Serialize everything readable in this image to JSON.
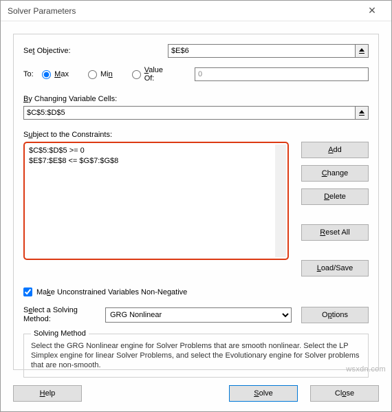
{
  "title": "Solver Parameters",
  "objective": {
    "label_pre": "Se",
    "label_und": "t",
    "label_post": " Objective:",
    "value": "$E$6"
  },
  "to": {
    "label": "To:",
    "max_und": "M",
    "max_post": "ax",
    "min_und": "M",
    "min_pre": "Mi",
    "min_post": "n",
    "min_label_pre": "Mi",
    "min_label_und": "n",
    "valueof_und": "V",
    "valueof_post": "alue Of:",
    "valueof_value": "0"
  },
  "changing": {
    "label_und": "B",
    "label_post": "y Changing Variable Cells:",
    "value": "$C$5:$D$5"
  },
  "constraints": {
    "label_pre": "S",
    "label_und": "u",
    "label_post": "bject to the Constraints:",
    "items": [
      "$C$5:$D$5 >= 0",
      "$E$7:$E$8 <= $G$7:$G$8"
    ]
  },
  "side": {
    "add_und": "A",
    "add_post": "dd",
    "change_und": "C",
    "change_post": "hange",
    "delete_und": "D",
    "delete_post": "elete",
    "reset_und": "R",
    "reset_post": "eset All",
    "load_und": "L",
    "load_post": "oad/Save"
  },
  "unconstrained": {
    "pre": "Ma",
    "und": "k",
    "post": "e Unconstrained Variables Non-Negative",
    "checked": true
  },
  "method": {
    "label_pre": "S",
    "label_und": "e",
    "label_post": "lect a Solving Method:",
    "selected": "GRG Nonlinear",
    "options_btn_pre": "O",
    "options_btn_und": "p",
    "options_btn_post": "tions"
  },
  "method_box": {
    "title": "Solving Method",
    "desc": "Select the GRG Nonlinear engine for Solver Problems that are smooth nonlinear. Select the LP Simplex engine for linear Solver Problems, and select the Evolutionary engine for Solver problems that are non-smooth."
  },
  "bottom": {
    "help_und": "H",
    "help_post": "elp",
    "solve_und": "S",
    "solve_post": "olve",
    "close_pre": "Cl",
    "close_und": "o",
    "close_post": "se"
  },
  "watermark": "wsxdn.com"
}
